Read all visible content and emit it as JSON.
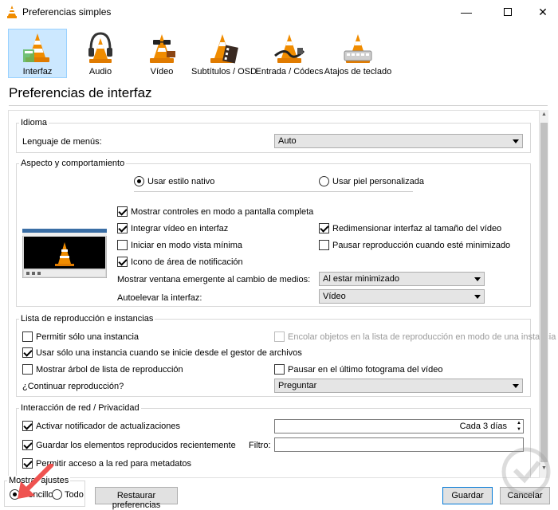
{
  "window": {
    "title": "Preferencias simples",
    "minimize_glyph": "—",
    "close_glyph": "✕"
  },
  "categories": [
    {
      "label": "Interfaz",
      "icon": "vlc-cone-interface-icon"
    },
    {
      "label": "Audio",
      "icon": "vlc-cone-headphones-icon"
    },
    {
      "label": "Vídeo",
      "icon": "vlc-cone-glasses-icon"
    },
    {
      "label": "Subtítulos / OSD",
      "icon": "vlc-cone-film-icon"
    },
    {
      "label": "Entrada / Códecs",
      "icon": "vlc-cone-cable-icon"
    },
    {
      "label": "Atajos de teclado",
      "icon": "vlc-cone-hotkeys-icon"
    }
  ],
  "section_title": "Preferencias de interfaz",
  "idioma": {
    "group_title": "Idioma",
    "menu_language_label": "Lenguaje de menús:",
    "menu_language_value": "Auto"
  },
  "aspecto": {
    "group_title": "Aspecto y comportamiento",
    "radio_native": "Usar estilo nativo",
    "radio_skin": "Usar piel personalizada",
    "cb_fullscreen_controls": "Mostrar controles en modo a pantalla completa",
    "cb_integrate_video": "Integrar vídeo en interfaz",
    "cb_resize_interface": "Redimensionar interfaz al tamaño del vídeo",
    "cb_minimal_view": "Iniciar en modo vista mínima",
    "cb_pause_minimized": "Pausar reproducción cuando esté minimizado",
    "cb_tray_icon": "Icono de área de notificación",
    "popup_label": "Mostrar ventana emergente al cambio de medios:",
    "popup_value": "Al estar minimizado",
    "raise_label": "Autoelevar la interfaz:",
    "raise_value": "Vídeo"
  },
  "playlist": {
    "group_title": "Lista de reproducción e instancias",
    "cb_one_instance": "Permitir sólo una instancia",
    "cb_enqueue": "Encolar objetos en la lista de reproducción en modo de una instancia",
    "cb_one_instance_fm": "Usar sólo una instancia cuando se inicie desde el gestor de archivos",
    "cb_tree": "Mostrar árbol de lista de reproducción",
    "cb_pause_last": "Pausar en el último fotograma del vídeo",
    "continue_label": "¿Continuar reproducción?",
    "continue_value": "Preguntar"
  },
  "network": {
    "group_title": "Interacción de red / Privacidad",
    "cb_updates": "Activar notificador de actualizaciones",
    "updates_value": "Cada 3 días",
    "cb_save_recent": "Guardar los elementos reproducidos recientemente",
    "filter_label": "Filtro:",
    "filter_value": "",
    "cb_metadata": "Permitir acceso a la red para metadatos"
  },
  "footer": {
    "show_settings_label": "Mostrar ajustes",
    "radio_simple": "Sencillo",
    "radio_all": "Todo",
    "reset_button": "Restaurar preferencias",
    "save_button": "Guardar",
    "cancel_button": "Cancelar"
  },
  "colors": {
    "active_category_bg": "#cce8ff",
    "vlc_orange": "#f08c00",
    "annotation_arrow": "#ef5350"
  }
}
